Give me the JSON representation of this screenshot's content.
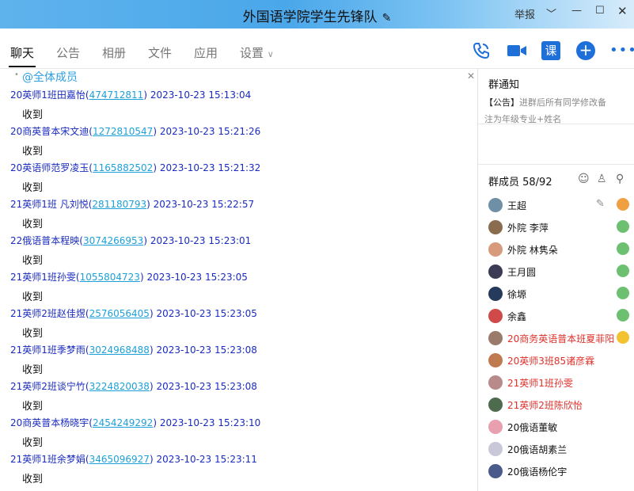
{
  "window": {
    "title": "外国语学院学生先锋队",
    "report": "举报",
    "colors": {
      "accent": "#1e6fd9",
      "sender": "#1a2bc0",
      "qq": "#1ea0d8",
      "admin_red": "#e0302a"
    }
  },
  "tabs": [
    {
      "label": "聊天",
      "active": true
    },
    {
      "label": "公告"
    },
    {
      "label": "相册"
    },
    {
      "label": "文件"
    },
    {
      "label": "应用"
    },
    {
      "label": "设置"
    }
  ],
  "toolbar": {
    "icons": [
      "phone-icon",
      "video-icon",
      "course-icon",
      "add-icon",
      "more-icon"
    ],
    "course_label": "课"
  },
  "chat": {
    "at_all": "@全体成员",
    "messages": [
      {
        "name": "20英师1班田嘉怡",
        "qq": "474712811",
        "time": "2023-10-23 15:13:04",
        "text": "收到"
      },
      {
        "name": "20商英普本宋文迪",
        "qq": "1272810547",
        "time": "2023-10-23 15:21:26",
        "text": "收到"
      },
      {
        "name": "20英语师范罗凌玉",
        "qq": "1165882502",
        "time": "2023-10-23 15:21:32",
        "text": "收到"
      },
      {
        "name": "21英师1班 凡刘悦",
        "qq": "281180793",
        "time": "2023-10-23 15:22:57",
        "text": "收到"
      },
      {
        "name": "22俄语普本程映",
        "qq": "3074266953",
        "time": "2023-10-23 15:23:01",
        "text": "收到"
      },
      {
        "name": "21英师1班孙雯",
        "qq": "1055804723",
        "time": "2023-10-23 15:23:05",
        "text": "收到"
      },
      {
        "name": "21英师2班赵佳煜",
        "qq": "2576056405",
        "time": "2023-10-23 15:23:05",
        "text": "收到"
      },
      {
        "name": "21英师1班季梦雨",
        "qq": "3024968488",
        "time": "2023-10-23 15:23:08",
        "text": "收到"
      },
      {
        "name": "21英师2班谈宁竹",
        "qq": "3224820038",
        "time": "2023-10-23 15:23:08",
        "text": "收到"
      },
      {
        "name": "20商英普本杨晓宇",
        "qq": "2454249292",
        "time": "2023-10-23 15:23:10",
        "text": "收到"
      },
      {
        "name": "21英师1班余梦娟",
        "qq": "3465096927",
        "time": "2023-10-23 15:23:11",
        "text": "收到"
      }
    ]
  },
  "notice": {
    "title": "群通知",
    "tag": "【公告】",
    "line1": "进群后所有同学修改备",
    "line2": "注为年级专业+姓名"
  },
  "members": {
    "header": "群成员 58/92",
    "list": [
      {
        "name": "王超",
        "avatar_color": "#6f8fa6",
        "badge_color": "#f0a040",
        "red": false
      },
      {
        "name": "外院 李萍",
        "avatar_color": "#8a6d4f",
        "badge_color": "#6cc070",
        "red": false
      },
      {
        "name": "外院 林隽朵",
        "avatar_color": "#d79a7d",
        "badge_color": "#6cc070",
        "red": false
      },
      {
        "name": "王月圆",
        "avatar_color": "#3b3b55",
        "badge_color": "#6cc070",
        "red": false
      },
      {
        "name": "徐塬",
        "avatar_color": "#263a5c",
        "badge_color": "#6cc070",
        "red": false
      },
      {
        "name": "余鑫",
        "avatar_color": "#d04a4a",
        "badge_color": "#6cc070",
        "red": false
      },
      {
        "name": "20商务英语普本班夏菲阳",
        "avatar_color": "#9a7a6a",
        "badge_color": "#f2c230",
        "red": true
      },
      {
        "name": "20英师3班85诸彦霖",
        "avatar_color": "#c07a50",
        "badge_color": "",
        "red": true
      },
      {
        "name": "21英师1班孙雯",
        "avatar_color": "#b88a8a",
        "badge_color": "",
        "red": true
      },
      {
        "name": "21英师2班陈欣怡",
        "avatar_color": "#4d6b4d",
        "badge_color": "",
        "red": true
      },
      {
        "name": "20俄语董敏",
        "avatar_color": "#e8a0b0",
        "badge_color": "",
        "red": false
      },
      {
        "name": "20俄语胡素兰",
        "avatar_color": "#c8c8d8",
        "badge_color": "",
        "red": false
      },
      {
        "name": "20俄语杨伦宇",
        "avatar_color": "#4a5a8a",
        "badge_color": "",
        "red": false
      }
    ]
  }
}
